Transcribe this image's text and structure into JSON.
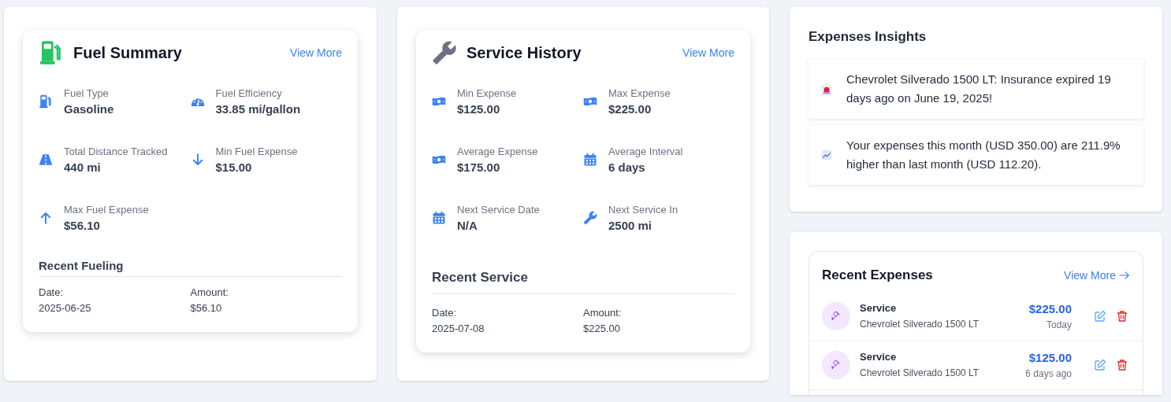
{
  "fuel_summary": {
    "title": "Fuel Summary",
    "link": "View More",
    "stats": [
      {
        "label": "Fuel Type",
        "value": "Gasoline"
      },
      {
        "label": "Fuel Efficiency",
        "value": "33.85 mi/gallon"
      },
      {
        "label": "Total Distance Tracked",
        "value": "440 mi"
      },
      {
        "label": "Min Fuel Expense",
        "value": "$15.00"
      },
      {
        "label": "Max Fuel Expense",
        "value": "$56.10"
      }
    ],
    "recent": {
      "title": "Recent Fueling",
      "date_label": "Date:",
      "date": "2025-06-25",
      "amount_label": "Amount:",
      "amount": "$56.10"
    }
  },
  "service_history": {
    "title": "Service History",
    "link": "View More",
    "stats": [
      {
        "label": "Min Expense",
        "value": "$125.00"
      },
      {
        "label": "Max Expense",
        "value": "$225.00"
      },
      {
        "label": "Average Expense",
        "value": "$175.00"
      },
      {
        "label": "Average Interval",
        "value": "6 days"
      },
      {
        "label": "Next Service Date",
        "value": "N/A"
      },
      {
        "label": "Next Service In",
        "value": "2500 mi"
      }
    ],
    "recent": {
      "title": "Recent Service",
      "date_label": "Date:",
      "date": "2025-07-08",
      "amount_label": "Amount:",
      "amount": "$225.00"
    }
  },
  "expenses_insights": {
    "title": "Expenses Insights",
    "items": [
      {
        "text": "Chevrolet Silverado 1500 LT: Insurance expired 19 days ago on June 19, 2025!"
      },
      {
        "text": "Your expenses this month (USD 350.00) are 211.9% higher than last month (USD 112.20)."
      }
    ]
  },
  "recent_expenses": {
    "title": "Recent Expenses",
    "link": "View More",
    "items": [
      {
        "category": "Service",
        "vehicle": "Chevrolet Silverado 1500 LT",
        "amount": "$225.00",
        "when": "Today"
      },
      {
        "category": "Service",
        "vehicle": "Chevrolet Silverado 1500 LT",
        "amount": "$125.00",
        "when": "6 days ago"
      }
    ]
  }
}
